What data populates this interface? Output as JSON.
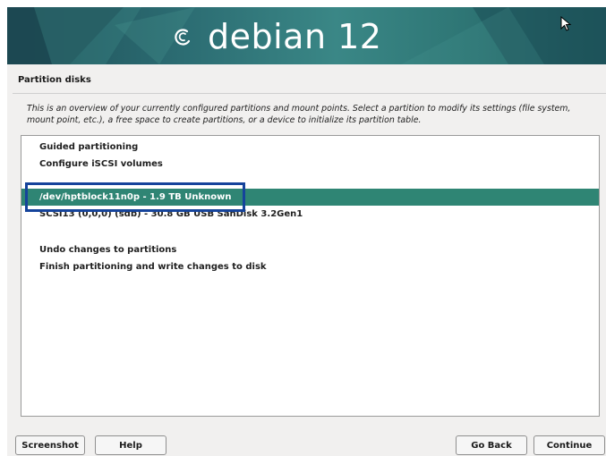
{
  "banner": {
    "brand": "debian 12",
    "logo_icon": "debian-swirl-icon",
    "cursor_icon": "mouse-pointer-icon"
  },
  "page": {
    "title": "Partition disks",
    "description": "This is an overview of your currently configured partitions and mount points. Select a partition to modify its settings (file system, mount point, etc.), a free space to create partitions, or a device to initialize its partition table."
  },
  "list": {
    "items": [
      "Guided partitioning",
      "Configure iSCSI volumes",
      "/dev/hptblock11n0p - 1.9 TB Unknown",
      "SCSI13 (0,0,0) (sdb) - 30.8 GB  USB  SanDisk 3.2Gen1",
      "Undo changes to partitions",
      "Finish partitioning and write changes to disk"
    ],
    "selected_index": 2
  },
  "buttons": {
    "screenshot": "Screenshot",
    "help": "Help",
    "go_back": "Go Back",
    "continue": "Continue"
  },
  "colors": {
    "selection": "#2f8574",
    "annotation_box": "#15439b"
  }
}
